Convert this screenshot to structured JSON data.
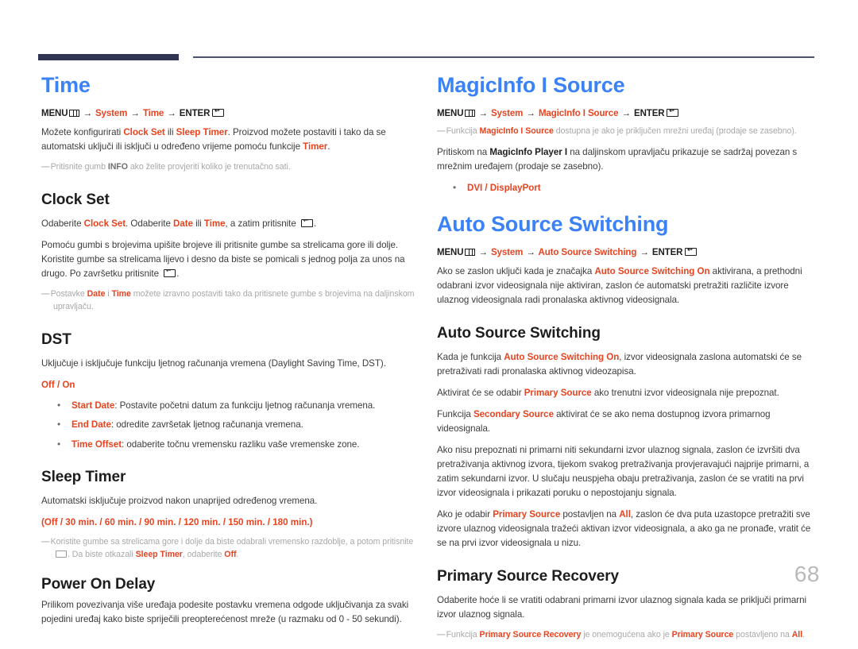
{
  "meta": {
    "page_number": "68",
    "accent_blue": "#3b82f6",
    "accent_red": "#e8431f",
    "rule_navy": "#2f3452",
    "note_grey": "#a8a8a8"
  },
  "icons": {
    "menu": "menu-grid-icon",
    "enter": "enter-return-icon"
  },
  "left_column": {
    "chapter_title": "Time",
    "menu_path": {
      "menu_label": "MENU",
      "items": [
        "System",
        "Time"
      ],
      "enter_label": "ENTER"
    },
    "intro_p1": {
      "t1": "Možete konfigurirati ",
      "r1": "Clock Set",
      "t2": " ili ",
      "r2": "Sleep Timer",
      "t3": ". Proizvod možete postaviti i tako da se automatski uključi ili isključi u određeno vrijeme pomoću funkcije ",
      "r3": "Timer",
      "t4": "."
    },
    "intro_note": {
      "t1": "Pritisnite gumb ",
      "b1": "INFO",
      "t2": " ako želite provjeriti koliko je trenutačno sati."
    },
    "sections": [
      {
        "heading": "Clock Set",
        "p1": {
          "t1": "Odaberite ",
          "r1": "Clock Set",
          "t2": ". Odaberite ",
          "r2": "Date",
          "t3": " ili ",
          "r3": "Time",
          "t4": ", a zatim pritisnite ",
          "t5": "."
        },
        "p2": "Pomoću gumbi s brojevima upišite brojeve ili pritisnite gumbe sa strelicama gore ili dolje. Koristite gumbe sa strelicama lijevo i desno da biste se pomicali s jednog polja za unos na drugo. Po završetku pritisnite ",
        "p2_end": ".",
        "note": {
          "t1": "Postavke ",
          "r1": "Date",
          "t2": " i ",
          "r2": "Time",
          "t3": " možete izravno postaviti tako da pritisnete gumbe s brojevima na daljinskom upravljaču."
        }
      },
      {
        "heading": "DST",
        "p1": "Uključuje i isključuje funkciju ljetnog računanja vremena (Daylight Saving Time, DST).",
        "options": "Off / On",
        "bullets": [
          {
            "label": "Start Date",
            "text": ": Postavite početni datum za funkciju ljetnog računanja vremena."
          },
          {
            "label": "End Date",
            "text": ": odredite završetak ljetnog računanja vremena."
          },
          {
            "label": "Time Offset",
            "text": ": odaberite točnu vremensku razliku vaše vremenske zone."
          }
        ]
      },
      {
        "heading": "Sleep Timer",
        "p1": "Automatski isključuje proizvod nakon unaprijed određenog vremena.",
        "options": "(Off / 30 min. / 60 min. / 90 min. / 120 min. / 150 min. / 180 min.)",
        "note": {
          "t1": "Koristite gumbe sa strelicama gore i dolje da biste odabrali vremensko razdoblje, a potom pritisnite ",
          "t2": ". Da biste otkazali ",
          "r1": "Sleep Timer",
          "t3": ", odaberite ",
          "r2": "Off",
          "t4": "."
        }
      },
      {
        "heading": "Power On Delay",
        "p1": "Prilikom povezivanja više uređaja podesite postavku vremena odgode uključivanja za svaki pojedini uređaj kako biste spriječili preopterećenost mreže (u razmaku od 0 - 50 sekundi)."
      }
    ]
  },
  "right_column": {
    "block1": {
      "chapter_title": "MagicInfo I Source",
      "menu_path": {
        "menu_label": "MENU",
        "items": [
          "System",
          "MagicInfo I Source"
        ],
        "enter_label": "ENTER"
      },
      "note": {
        "t1": "Funkcija ",
        "r1": "MagicInfo I Source",
        "t2": " dostupna je ako je priključen mrežni uređaj (prodaje se zasebno)."
      },
      "p1": {
        "t1": "Pritiskom na ",
        "b1": "MagicInfo Player I",
        "t2": " na daljinskom upravljaču prikazuje se sadržaj povezan s mrežnim uređajem (prodaje se zasebno)."
      },
      "bullets": [
        {
          "label": "DVI / DisplayPort",
          "text": ""
        }
      ]
    },
    "block2": {
      "chapter_title": "Auto Source Switching",
      "menu_path": {
        "menu_label": "MENU",
        "items": [
          "System",
          "Auto Source Switching"
        ],
        "enter_label": "ENTER"
      },
      "p1": {
        "t1": "Ako se zaslon uključi kada je značajka ",
        "r1": "Auto Source Switching On",
        "t2": " aktivirana, a prethodni odabrani izvor videosignala nije aktiviran, zaslon će automatski pretražiti različite izvore ulaznog videosignala radi pronalaska aktivnog videosignala."
      },
      "sections": [
        {
          "heading": "Auto Source Switching",
          "paras": [
            {
              "t1": "Kada je funkcija ",
              "r1": "Auto Source Switching On",
              "t2": ", izvor videosignala zaslona automatski će se pretraživati radi pronalaska aktivnog videozapisa."
            },
            {
              "t1": "Aktivirat će se odabir ",
              "r1": "Primary Source",
              "t2": " ako trenutni izvor videosignala nije prepoznat."
            },
            {
              "t1": "Funkcija ",
              "r1": "Secondary Source",
              "t2": " aktivirat će se ako nema dostupnog izvora primarnog videosignala."
            },
            {
              "t1": "Ako nisu prepoznati ni primarni niti sekundarni izvor ulaznog signala, zaslon će izvršiti dva pretraživanja aktivnog izvora, tijekom svakog pretraživanja provjeravajući najprije primarni, a zatim sekundarni izvor. U slučaju neuspjeha obaju pretraživanja, zaslon će se vratiti na prvi izvor videosignala i prikazati poruku o nepostojanju signala.",
              "r1": "",
              "t2": ""
            },
            {
              "t1": "Ako je odabir ",
              "r1": "Primary Source",
              "t2": " postavljen na ",
              "r2": "All",
              "t3": ", zaslon će dva puta uzastopce pretražiti sve izvore ulaznog videosignala tražeći aktivan izvor videosignala, a ako ga ne pronađe, vratit će se na prvi izvor videosignala u nizu."
            }
          ]
        },
        {
          "heading": "Primary Source Recovery",
          "p1": "Odaberite hoće li se vratiti odabrani primarni izvor ulaznog signala kada se priključi primarni izvor ulaznog signala.",
          "note": {
            "t1": "Funkcija ",
            "r1": "Primary Source Recovery",
            "t2": " je onemogućena ako je ",
            "r2": "Primary Source",
            "t3": " postavljeno na ",
            "r3": "All",
            "t4": "."
          }
        }
      ]
    }
  }
}
